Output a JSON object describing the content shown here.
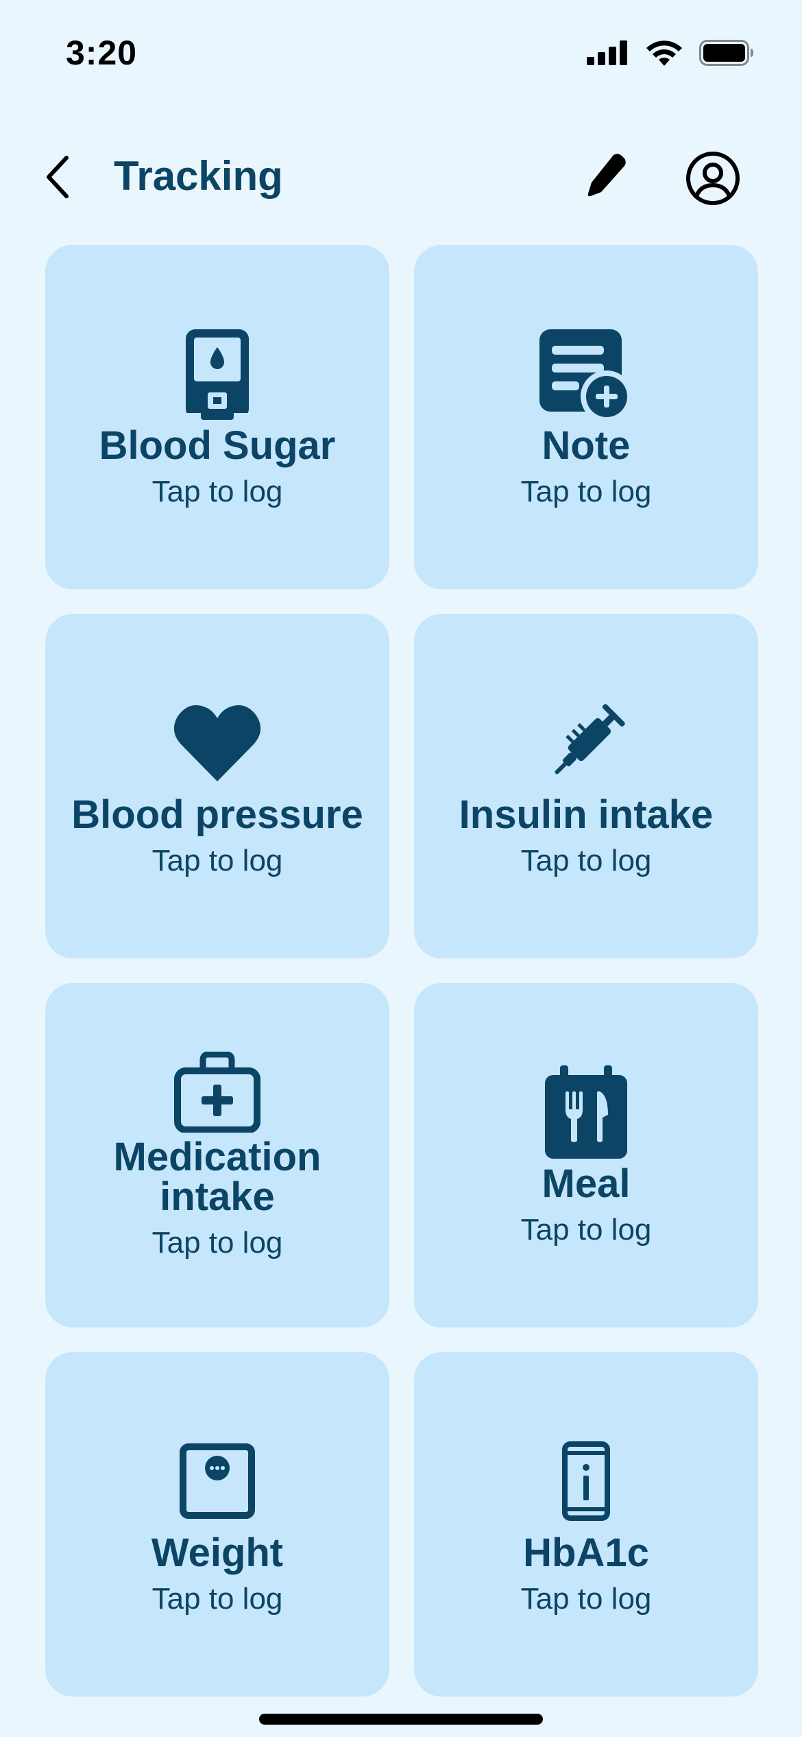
{
  "status_bar": {
    "time": "3:20"
  },
  "header": {
    "title": "Tracking"
  },
  "tiles": [
    {
      "title": "Blood Sugar",
      "subtitle": "Tap to log"
    },
    {
      "title": "Note",
      "subtitle": "Tap to log"
    },
    {
      "title": "Blood pressure",
      "subtitle": "Tap to log"
    },
    {
      "title": "Insulin intake",
      "subtitle": "Tap to log"
    },
    {
      "title": "Medication intake",
      "subtitle": "Tap to log"
    },
    {
      "title": "Meal",
      "subtitle": "Tap to log"
    },
    {
      "title": "Weight",
      "subtitle": "Tap to log"
    },
    {
      "title": "HbA1c",
      "subtitle": "Tap to log"
    }
  ],
  "icons": [
    "glucose-meter-icon",
    "note-add-icon",
    "heart-icon",
    "syringe-icon",
    "medical-kit-icon",
    "meal-calendar-icon",
    "scale-icon",
    "phone-info-icon"
  ],
  "colors": {
    "background": "#eaf6fd",
    "tile": "#c5e6fb",
    "accent": "#0c4465"
  }
}
